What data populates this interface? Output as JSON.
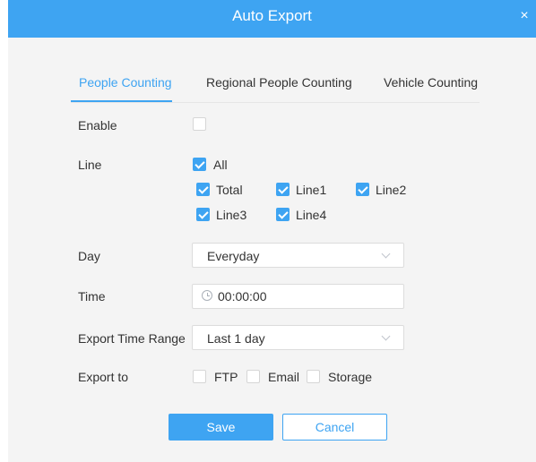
{
  "dialog": {
    "title": "Auto Export",
    "close_symbol": "×"
  },
  "tabs": [
    {
      "label": "People Counting",
      "active": true
    },
    {
      "label": "Regional People Counting",
      "active": false
    },
    {
      "label": "Vehicle Counting",
      "active": false
    }
  ],
  "form": {
    "enable": {
      "label": "Enable",
      "checked": false
    },
    "line": {
      "label": "Line",
      "all": {
        "label": "All",
        "checked": true
      },
      "options": [
        {
          "label": "Total",
          "checked": true
        },
        {
          "label": "Line1",
          "checked": true
        },
        {
          "label": "Line2",
          "checked": true
        },
        {
          "label": "Line3",
          "checked": true
        },
        {
          "label": "Line4",
          "checked": true
        }
      ]
    },
    "day": {
      "label": "Day",
      "value": "Everyday"
    },
    "time": {
      "label": "Time",
      "value": "00:00:00"
    },
    "export_time_range": {
      "label": "Export Time Range",
      "value": "Last 1 day"
    },
    "export_to": {
      "label": "Export to",
      "options": [
        {
          "label": "FTP",
          "checked": false
        },
        {
          "label": "Email",
          "checked": false
        },
        {
          "label": "Storage",
          "checked": false
        }
      ]
    }
  },
  "buttons": {
    "save": "Save",
    "cancel": "Cancel"
  },
  "colors": {
    "accent": "#3ea4f2",
    "panel_bg": "#f4f4f4"
  }
}
